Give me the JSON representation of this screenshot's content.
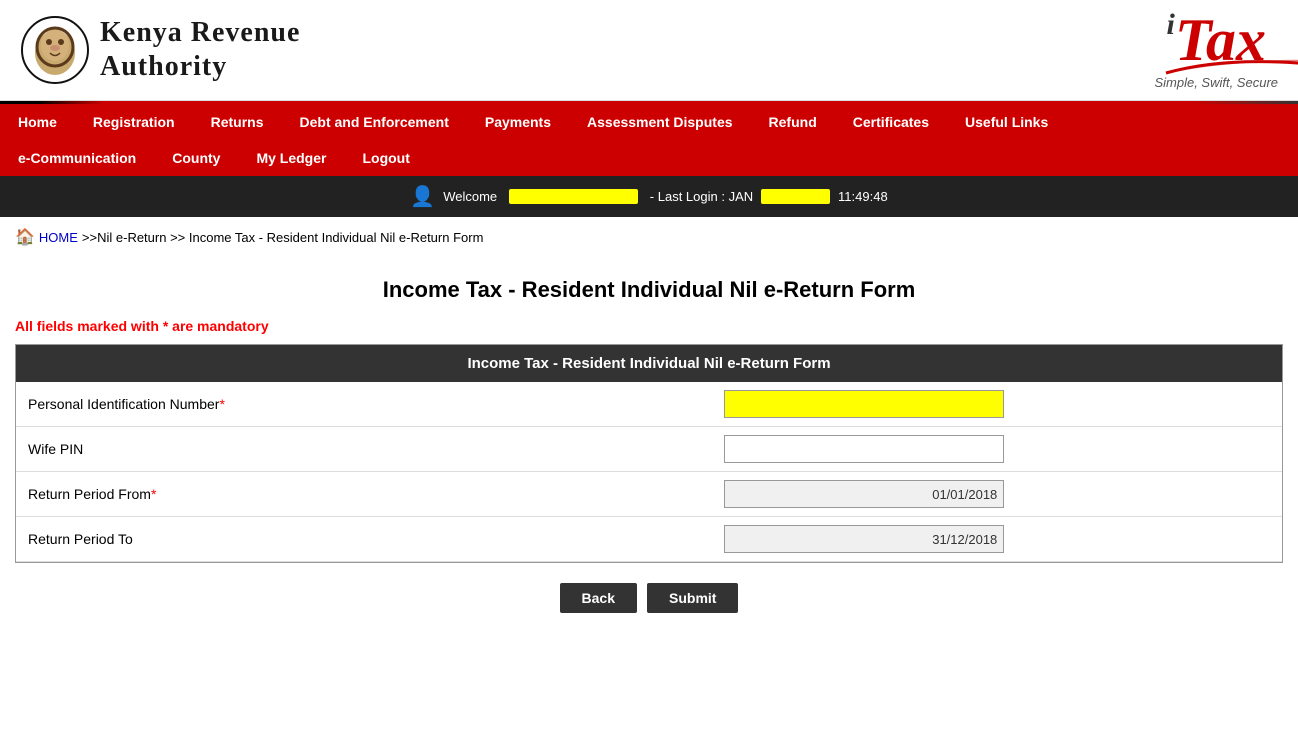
{
  "header": {
    "kra_name_line1": "Kenya Revenue",
    "kra_name_line2": "Authority",
    "itax_brand": "iTax",
    "itax_tagline": "Simple, Swift, Secure"
  },
  "nav": {
    "row1": [
      {
        "label": "Home",
        "id": "home"
      },
      {
        "label": "Registration",
        "id": "registration"
      },
      {
        "label": "Returns",
        "id": "returns"
      },
      {
        "label": "Debt and Enforcement",
        "id": "debt-enforcement"
      },
      {
        "label": "Payments",
        "id": "payments"
      },
      {
        "label": "Assessment Disputes",
        "id": "assessment-disputes"
      },
      {
        "label": "Refund",
        "id": "refund"
      },
      {
        "label": "Certificates",
        "id": "certificates"
      },
      {
        "label": "Useful Links",
        "id": "useful-links"
      }
    ],
    "row2": [
      {
        "label": "e-Communication",
        "id": "e-communication"
      },
      {
        "label": "County",
        "id": "county"
      },
      {
        "label": "My Ledger",
        "id": "my-ledger"
      },
      {
        "label": "Logout",
        "id": "logout"
      }
    ]
  },
  "welcome_bar": {
    "welcome_prefix": "Welcome",
    "login_label": "- Last Login : JAN",
    "login_time": "11:49:48"
  },
  "breadcrumb": {
    "home_label": "HOME",
    "path": ">>Nil e-Return >> Income Tax - Resident Individual Nil e-Return Form"
  },
  "page_title": "Income Tax - Resident Individual Nil e-Return Form",
  "mandatory_note": "All fields marked with * are mandatory",
  "form": {
    "header": "Income Tax - Resident Individual Nil e-Return Form",
    "fields": [
      {
        "label": "Personal Identification Number",
        "required": true,
        "value": "",
        "placeholder": "",
        "type": "pin"
      },
      {
        "label": "Wife PIN",
        "required": false,
        "value": "",
        "placeholder": "",
        "type": "text"
      },
      {
        "label": "Return Period From",
        "required": true,
        "value": "01/01/2018",
        "type": "date"
      },
      {
        "label": "Return Period To",
        "required": false,
        "value": "31/12/2018",
        "type": "date"
      }
    ]
  },
  "buttons": {
    "back_label": "Back",
    "submit_label": "Submit"
  }
}
